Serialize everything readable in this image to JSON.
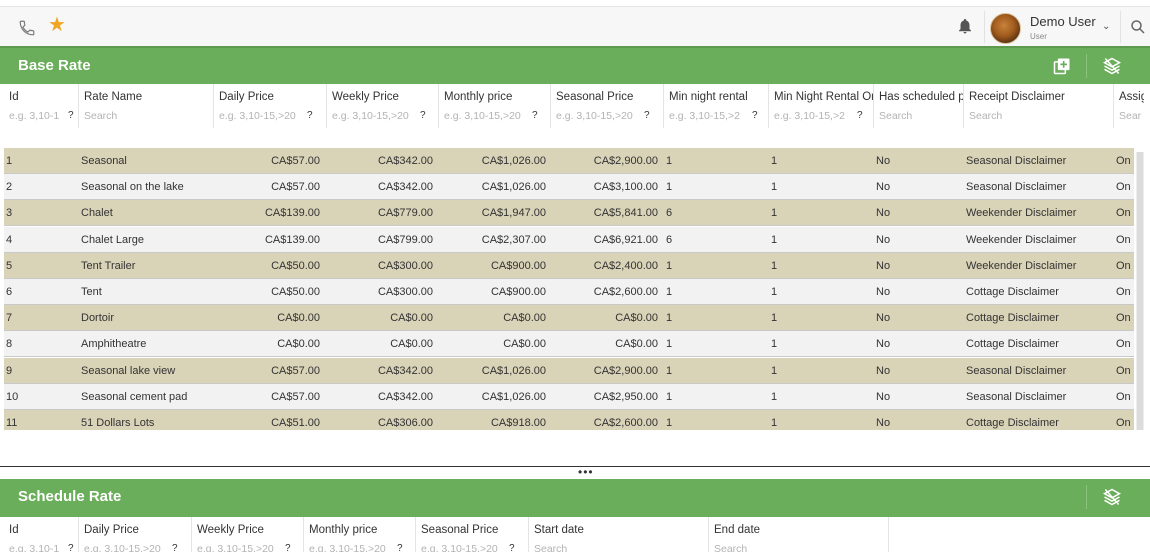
{
  "user": {
    "name": "Demo User",
    "role": "User"
  },
  "icons": {
    "phone": "phone-icon",
    "favorite": "star-icon",
    "notifications": "bell-icon",
    "search": "search-icon",
    "add": "add-icon",
    "layers": "layers-icon"
  },
  "colors": {
    "header_green": "#6aad5a",
    "row_odd": "#d9d3b8",
    "row_even": "#f2f2f2",
    "star": "#f0a623"
  },
  "base_rate": {
    "title": "Base Rate",
    "columns": [
      {
        "label": "Id",
        "filter": "e.g. 3,10-1"
      },
      {
        "label": "Rate Name",
        "filter": "Search"
      },
      {
        "label": "Daily Price",
        "filter": "e.g. 3,10-15,>20"
      },
      {
        "label": "Weekly Price",
        "filter": "e.g. 3,10-15,>20"
      },
      {
        "label": "Monthly price",
        "filter": "e.g. 3,10-15,>20"
      },
      {
        "label": "Seasonal Price",
        "filter": "e.g. 3,10-15,>20"
      },
      {
        "label": "Min night rental",
        "filter": "e.g. 3,10-15,>2"
      },
      {
        "label": "Min Night Rental On",
        "filter": "e.g. 3,10-15,>2"
      },
      {
        "label": "Has scheduled pr",
        "filter": "Search"
      },
      {
        "label": "Receipt Disclaimer",
        "filter": "Search"
      },
      {
        "label": "Assig",
        "filter": "Sear"
      }
    ],
    "rows": [
      [
        "1",
        "Seasonal",
        "CA$57.00",
        "CA$342.00",
        "CA$1,026.00",
        "CA$2,900.00",
        "1",
        "1",
        "No",
        "Seasonal Disclaimer",
        "On"
      ],
      [
        "2",
        "Seasonal on the lake",
        "CA$57.00",
        "CA$342.00",
        "CA$1,026.00",
        "CA$3,100.00",
        "1",
        "1",
        "No",
        "Seasonal Disclaimer",
        "On"
      ],
      [
        "3",
        "Chalet",
        "CA$139.00",
        "CA$779.00",
        "CA$1,947.00",
        "CA$5,841.00",
        "6",
        "1",
        "No",
        "Weekender Disclaimer",
        "On"
      ],
      [
        "4",
        "Chalet Large",
        "CA$139.00",
        "CA$799.00",
        "CA$2,307.00",
        "CA$6,921.00",
        "6",
        "1",
        "No",
        "Weekender Disclaimer",
        "On"
      ],
      [
        "5",
        "Tent Trailer",
        "CA$50.00",
        "CA$300.00",
        "CA$900.00",
        "CA$2,400.00",
        "1",
        "1",
        "No",
        "Weekender Disclaimer",
        "On"
      ],
      [
        "6",
        "Tent",
        "CA$50.00",
        "CA$300.00",
        "CA$900.00",
        "CA$2,600.00",
        "1",
        "1",
        "No",
        "Cottage Disclaimer",
        "On"
      ],
      [
        "7",
        "Dortoir",
        "CA$0.00",
        "CA$0.00",
        "CA$0.00",
        "CA$0.00",
        "1",
        "1",
        "No",
        "Cottage Disclaimer",
        "On"
      ],
      [
        "8",
        "Amphitheatre",
        "CA$0.00",
        "CA$0.00",
        "CA$0.00",
        "CA$0.00",
        "1",
        "1",
        "No",
        "Cottage Disclaimer",
        "On"
      ],
      [
        "9",
        "Seasonal lake view",
        "CA$57.00",
        "CA$342.00",
        "CA$1,026.00",
        "CA$2,900.00",
        "1",
        "1",
        "No",
        "Seasonal Disclaimer",
        "On"
      ],
      [
        "10",
        "Seasonal cement pad",
        "CA$57.00",
        "CA$342.00",
        "CA$1,026.00",
        "CA$2,950.00",
        "1",
        "1",
        "No",
        "Seasonal Disclaimer",
        "On"
      ],
      [
        "11",
        "51 Dollars Lots",
        "CA$51.00",
        "CA$306.00",
        "CA$918.00",
        "CA$2,600.00",
        "1",
        "1",
        "No",
        "Cottage Disclaimer",
        "On"
      ]
    ]
  },
  "schedule_rate": {
    "title": "Schedule Rate",
    "columns": [
      {
        "label": "Id",
        "filter": "e.g. 3,10-1"
      },
      {
        "label": "Daily Price",
        "filter": "e.g. 3,10-15,>20"
      },
      {
        "label": "Weekly Price",
        "filter": "e.g. 3,10-15,>20"
      },
      {
        "label": "Monthly price",
        "filter": "e.g. 3,10-15,>20"
      },
      {
        "label": "Seasonal Price",
        "filter": "e.g. 3,10-15,>20"
      },
      {
        "label": "Start date",
        "filter": "Search"
      },
      {
        "label": "End date",
        "filter": "Search"
      }
    ]
  },
  "splitter": {
    "label": "•••"
  }
}
